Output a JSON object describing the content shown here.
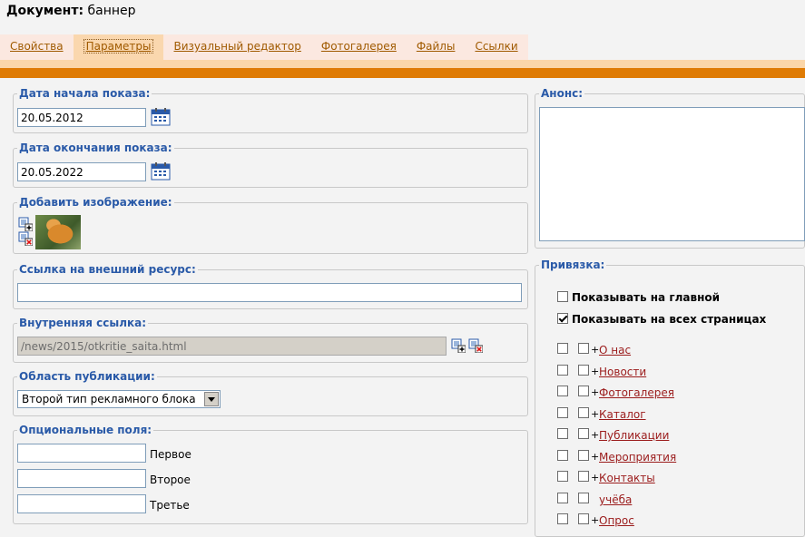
{
  "document": {
    "label": "Документ:",
    "name": "баннер"
  },
  "tabs": [
    {
      "label": "Свойства"
    },
    {
      "label": "Параметры",
      "active": true
    },
    {
      "label": "Визуальный редактор"
    },
    {
      "label": "Фотогалерея"
    },
    {
      "label": "Файлы"
    },
    {
      "label": "Ссылки"
    }
  ],
  "start_date": {
    "legend": "Дата начала показа:",
    "value": "20.05.2012"
  },
  "end_date": {
    "legend": "Дата окончания показа:",
    "value": "20.05.2022"
  },
  "image": {
    "legend": "Добавить изображение:"
  },
  "external_link": {
    "legend": "Ссылка на внешний ресурс:",
    "value": ""
  },
  "internal_link": {
    "legend": "Внутренняя ссылка:",
    "value": "/news/2015/otkritie_saita.html"
  },
  "publication_area": {
    "legend": "Область публикации:",
    "selected": "Второй тип рекламного блока"
  },
  "optional_fields": {
    "legend": "Опциональные поля:",
    "fields": [
      {
        "label": "Первое",
        "value": ""
      },
      {
        "label": "Второе",
        "value": ""
      },
      {
        "label": "Третье",
        "value": ""
      }
    ]
  },
  "anons": {
    "legend": "Анонс:",
    "value": ""
  },
  "binding": {
    "legend": "Привязка:",
    "show_main": {
      "label": "Показывать на главной",
      "checked": false
    },
    "show_all": {
      "label": "Показывать на всех страницах",
      "checked": true
    },
    "tree": [
      {
        "label": "О нас",
        "expandable": true
      },
      {
        "label": "Новости",
        "expandable": true
      },
      {
        "label": "Фотогалерея",
        "expandable": true
      },
      {
        "label": "Каталог",
        "expandable": true
      },
      {
        "label": "Публикации",
        "expandable": true
      },
      {
        "label": "Мероприятия",
        "expandable": true
      },
      {
        "label": "Контакты",
        "expandable": true
      },
      {
        "label": "учёба",
        "expandable": false
      },
      {
        "label": "Опрос",
        "expandable": true
      }
    ]
  },
  "colors": {
    "accent": "#df7b04",
    "legend": "#2a5aa8",
    "link": "#9b1c1c",
    "tab_bg": "#fbe8e0",
    "tab_active_bg": "#fad7ae"
  }
}
